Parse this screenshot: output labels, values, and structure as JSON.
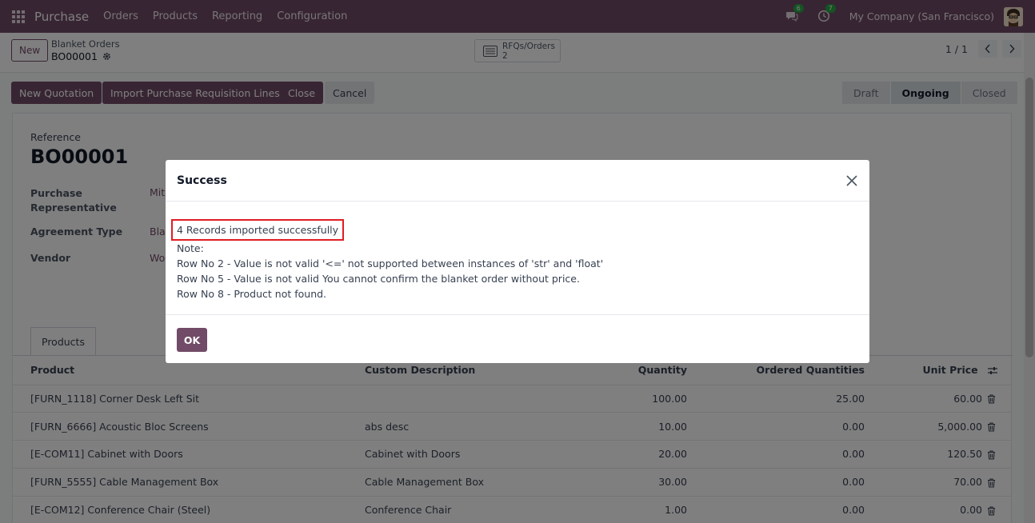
{
  "topnav": {
    "brand": "Purchase",
    "menu": [
      "Orders",
      "Products",
      "Reporting",
      "Configuration"
    ],
    "messages_count": "6",
    "activities_count": "7",
    "company": "My Company (San Francisco)"
  },
  "control_panel": {
    "new_label": "New",
    "breadcrumb_parent": "Blanket Orders",
    "breadcrumb_current": "BO00001",
    "smart_button_label": "RFQs/Orders",
    "smart_button_count": "2",
    "pager": "1 / 1"
  },
  "actions": {
    "new_quotation": "New Quotation",
    "import_lines": "Import Purchase Requisition Lines",
    "close": "Close",
    "cancel": "Cancel"
  },
  "status": [
    "Draft",
    "Ongoing",
    "Closed"
  ],
  "status_active": "Ongoing",
  "form": {
    "reference_label": "Reference",
    "reference_value": "BO00001",
    "purchase_rep_label": "Purchase Representative",
    "purchase_rep_value": "Mit",
    "agreement_type_label": "Agreement Type",
    "agreement_type_value": "Blar",
    "vendor_label": "Vendor",
    "vendor_value": "Woo"
  },
  "tabs": [
    "Products"
  ],
  "table": {
    "headers": [
      "Product",
      "Custom Description",
      "Quantity",
      "Ordered Quantities",
      "Unit Price"
    ],
    "rows": [
      [
        "[FURN_1118] Corner Desk Left Sit",
        "",
        "100.00",
        "25.00",
        "60.00"
      ],
      [
        "[FURN_6666] Acoustic Bloc Screens",
        "abs desc",
        "10.00",
        "0.00",
        "5,000.00"
      ],
      [
        "[E-COM11] Cabinet with Doors",
        "Cabinet with Doors",
        "20.00",
        "0.00",
        "120.50"
      ],
      [
        "[FURN_5555] Cable Management Box",
        "Cable Management Box",
        "30.00",
        "0.00",
        "70.00"
      ],
      [
        "[E-COM12] Conference Chair (Steel)",
        "Conference Chair",
        "1.00",
        "0.00",
        "0.00"
      ]
    ]
  },
  "modal": {
    "title": "Success",
    "success_line": "4 Records imported successfully",
    "note_label": "Note:",
    "notes": [
      "Row No 2  - Value is not valid '<=' not supported between instances of 'str' and 'float'",
      "Row No 5  - Value is not valid You cannot confirm the blanket order without price.",
      "Row No 8  - Product not found."
    ],
    "ok_label": "OK"
  }
}
